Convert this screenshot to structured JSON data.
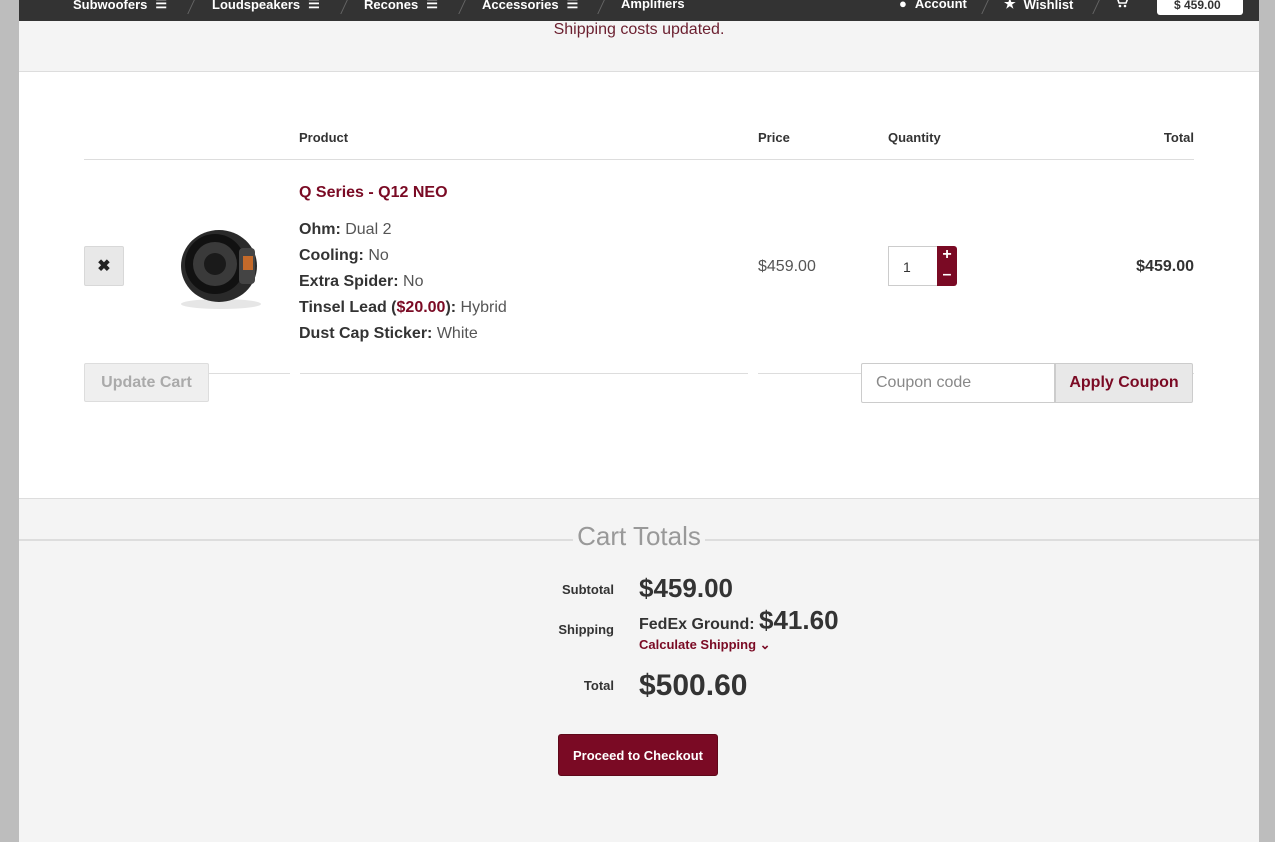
{
  "nav": {
    "items": [
      {
        "label": "Subwoofers"
      },
      {
        "label": "Loudspeakers"
      },
      {
        "label": "Recones"
      },
      {
        "label": "Accessories"
      },
      {
        "label": "Amplifiers"
      }
    ],
    "account_label": "Account",
    "wishlist_label": "Wishlist",
    "cart_total": "$  459.00"
  },
  "notice": "Shipping costs updated.",
  "table": {
    "headers": {
      "product": "Product",
      "price": "Price",
      "quantity": "Quantity",
      "total": "Total"
    },
    "rows": [
      {
        "name": "Q Series - Q12 NEO",
        "attributes": [
          {
            "key": "Ohm:",
            "value": " Dual 2"
          },
          {
            "key": "Cooling:",
            "value": " No"
          },
          {
            "key": "Extra Spider:",
            "value": " No"
          },
          {
            "key": "Tinsel Lead (",
            "extra": "$20.00",
            "key_end": "):",
            "value": " Hybrid"
          },
          {
            "key": "Dust Cap Sticker:",
            "value": " White"
          }
        ],
        "price": "$459.00",
        "quantity": "1",
        "total": "$459.00"
      }
    ]
  },
  "actions": {
    "update_cart": "Update Cart",
    "coupon_placeholder": "Coupon code",
    "apply_coupon": "Apply Coupon"
  },
  "totals": {
    "title": "Cart Totals",
    "subtotal_label": "Subtotal",
    "subtotal": "$459.00",
    "shipping_label": "Shipping",
    "shipping_method": "FedEx Ground: ",
    "shipping_amount": "$41.60",
    "calculate_shipping": "Calculate Shipping",
    "total_label": "Total",
    "total": "$500.60",
    "checkout": "Proceed to Checkout"
  },
  "colors": {
    "accent": "#7a0a24",
    "nav_bg": "#333333"
  }
}
